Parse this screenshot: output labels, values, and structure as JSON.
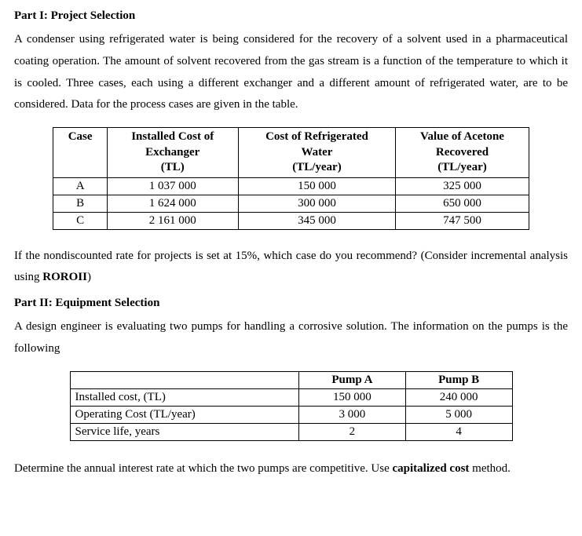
{
  "part1": {
    "heading": "Part I: Project Selection",
    "paragraph": "A condenser using refrigerated water is being considered for the recovery of a solvent used in a pharmaceutical coating operation. The amount of solvent recovered from the gas stream is a function of the temperature to which it is cooled. Three cases, each using a different exchanger and a different amount of refrigerated water, are to be considered. Data for the process cases are given in the table.",
    "table": {
      "headers": {
        "case": "Case",
        "cost_exchanger_l1": "Installed Cost of",
        "cost_exchanger_l2": "Exchanger",
        "cost_exchanger_l3": "(TL)",
        "cost_water_l1": "Cost of Refrigerated",
        "cost_water_l2": "Water",
        "cost_water_l3": "(TL/year)",
        "value_acetone_l1": "Value of Acetone",
        "value_acetone_l2": "Recovered",
        "value_acetone_l3": "(TL/year)"
      },
      "rows": [
        {
          "case": "A",
          "exchanger": "1 037 000",
          "water": "150 000",
          "acetone": "325 000"
        },
        {
          "case": "B",
          "exchanger": "1 624 000",
          "water": "300 000",
          "acetone": "650 000"
        },
        {
          "case": "C",
          "exchanger": "2 161 000",
          "water": "345 000",
          "acetone": "747 500"
        }
      ]
    },
    "followup_pre": "If the nondiscounted rate for projects is set at 15%, which case do you recommend? (Consider incremental analysis using ",
    "followup_bold": "ROROII",
    "followup_post": ")"
  },
  "part2": {
    "heading": "Part II: Equipment Selection",
    "paragraph": "A design engineer is evaluating two pumps for handling a corrosive solution. The information on the pumps is the following",
    "table": {
      "headers": {
        "blank": "",
        "pump_a": "Pump A",
        "pump_b": "Pump B"
      },
      "rows": [
        {
          "label": "Installed cost, (TL)",
          "a": "150 000",
          "b": "240 000"
        },
        {
          "label": "Operating Cost (TL/year)",
          "a": "3 000",
          "b": "5 000"
        },
        {
          "label": "Service life, years",
          "a": "2",
          "b": "4"
        }
      ]
    },
    "followup_pre": "Determine the annual interest rate at which the two pumps are competitive. Use ",
    "followup_bold": "capitalized cost",
    "followup_post": " method."
  }
}
